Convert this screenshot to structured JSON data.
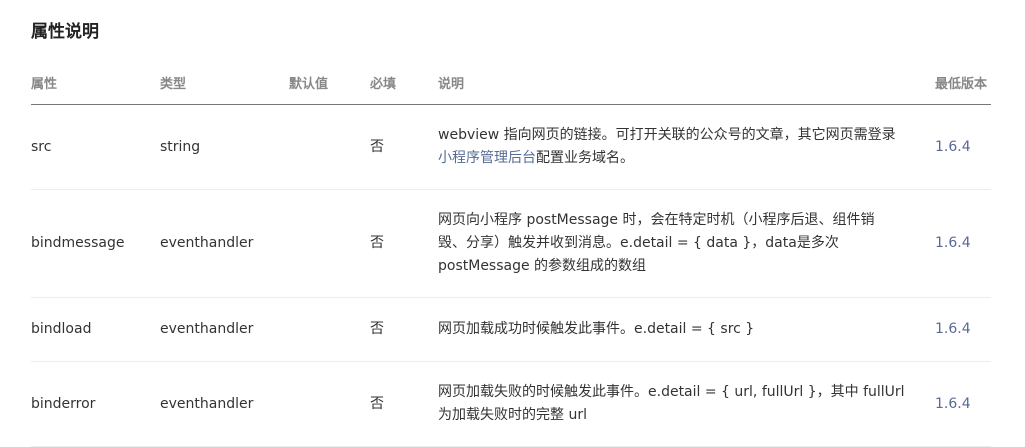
{
  "section_title": "属性说明",
  "columns": {
    "attr": "属性",
    "type": "类型",
    "default": "默认值",
    "required": "必填",
    "description": "说明",
    "min_version": "最低版本"
  },
  "rows": [
    {
      "attr": "src",
      "type": "string",
      "default": "",
      "required": "否",
      "desc_line1": "webview 指向网页的链接。可打开关联的公众号的文章，其它网页需登录",
      "desc_link": "小程序管理后台",
      "desc_after_link": "配置业务域名。",
      "version": "1.6.4"
    },
    {
      "attr": "bindmessage",
      "type": "eventhandler",
      "default": "",
      "required": "否",
      "desc_line1": "网页向小程序 postMessage 时，会在特定时机（小程序后退、组件销",
      "desc_line2": "毁、分享）触发并收到消息。e.detail = { data }，data是多次",
      "desc_line3": "postMessage 的参数组成的数组",
      "version": "1.6.4"
    },
    {
      "attr": "bindload",
      "type": "eventhandler",
      "default": "",
      "required": "否",
      "desc_line1": "网页加载成功时候触发此事件。e.detail = { src }",
      "version": "1.6.4"
    },
    {
      "attr": "binderror",
      "type": "eventhandler",
      "default": "",
      "required": "否",
      "desc_line1": "网页加载失败的时候触发此事件。e.detail = { url, fullUrl }，其中 fullUrl",
      "desc_line2": "为加载失败时的完整 url",
      "version": "1.6.4"
    }
  ]
}
